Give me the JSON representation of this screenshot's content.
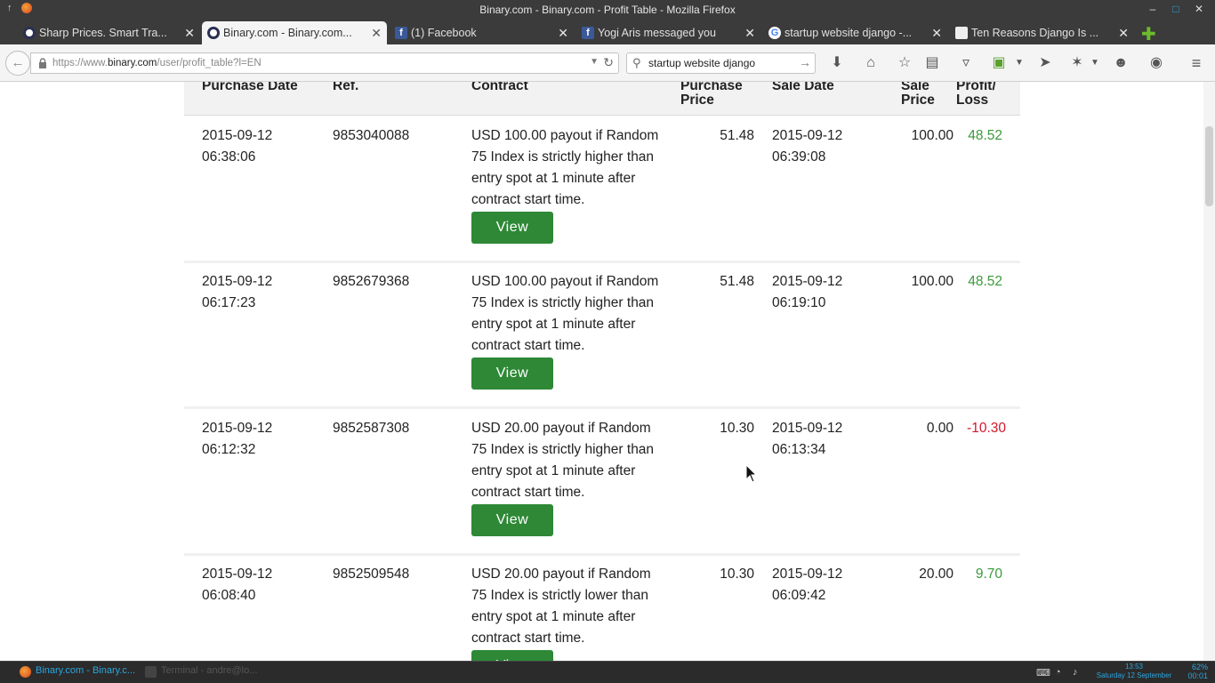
{
  "window": {
    "title": "Binary.com - Binary.com - Profit Table - Mozilla Firefox"
  },
  "tabs": [
    {
      "label": "Sharp Prices. Smart Tra...",
      "icon": "binary-favicon",
      "active": false
    },
    {
      "label": "Binary.com - Binary.com...",
      "icon": "binary-favicon",
      "active": true
    },
    {
      "label": "(1) Facebook",
      "icon": "facebook-favicon",
      "active": false
    },
    {
      "label": "Yogi Aris messaged you",
      "icon": "facebook-favicon",
      "active": false
    },
    {
      "label": "startup website django -...",
      "icon": "google-favicon",
      "active": false
    },
    {
      "label": "Ten Reasons Django Is ...",
      "icon": "calendar-favicon",
      "active": false
    }
  ],
  "nav": {
    "url_prefix": "https://www.",
    "url_host": "binary.com",
    "url_path": "/user/profit_table?l=EN",
    "search_value": "startup website django"
  },
  "table": {
    "headers": {
      "purchase_date": "Purchase Date",
      "ref": "Ref.",
      "contract": "Contract",
      "purchase_price_1": "Purchase",
      "purchase_price_2": "Price",
      "sale_date": "Sale Date",
      "sale_price_1": "Sale",
      "sale_price_2": "Price",
      "profit_1": "Profit/",
      "profit_2": "Loss"
    },
    "view_label": "View",
    "rows": [
      {
        "purchase_date": "2015-09-12",
        "purchase_time": "06:38:06",
        "ref": "9853040088",
        "contract_lines": [
          "USD 100.00 payout if Random",
          "75 Index is strictly higher than",
          "entry spot at 1 minute after",
          "contract start time."
        ],
        "purchase_price": "51.48",
        "sale_date": "2015-09-12",
        "sale_time": "06:39:08",
        "sale_price": "100.00",
        "profit": "48.52",
        "profit_type": "profit"
      },
      {
        "purchase_date": "2015-09-12",
        "purchase_time": "06:17:23",
        "ref": "9852679368",
        "contract_lines": [
          "USD 100.00 payout if Random",
          "75 Index is strictly higher than",
          "entry spot at 1 minute after",
          "contract start time."
        ],
        "purchase_price": "51.48",
        "sale_date": "2015-09-12",
        "sale_time": "06:19:10",
        "sale_price": "100.00",
        "profit": "48.52",
        "profit_type": "profit"
      },
      {
        "purchase_date": "2015-09-12",
        "purchase_time": "06:12:32",
        "ref": "9852587308",
        "contract_lines": [
          "USD 20.00 payout if Random",
          "75 Index is strictly higher than",
          "entry spot at 1 minute after",
          "contract start time."
        ],
        "purchase_price": "10.30",
        "sale_date": "2015-09-12",
        "sale_time": "06:13:34",
        "sale_price": "0.00",
        "profit": "-10.30",
        "profit_type": "loss"
      },
      {
        "purchase_date": "2015-09-12",
        "purchase_time": "06:08:40",
        "ref": "9852509548",
        "contract_lines": [
          "USD 20.00 payout if Random",
          "75 Index is strictly lower than",
          "entry spot at 1 minute after",
          "contract start time."
        ],
        "purchase_price": "10.30",
        "sale_date": "2015-09-12",
        "sale_time": "06:09:42",
        "sale_price": "20.00",
        "profit": "9.70",
        "profit_type": "profit"
      }
    ]
  },
  "taskbar": {
    "items": [
      {
        "label": "Binary.com - Binary.c...",
        "icon": "firefox-icon",
        "active": true
      },
      {
        "label": "Terminal - andre@lo...",
        "icon": "terminal-icon",
        "active": false
      }
    ],
    "clock_time": "13:53",
    "clock_date": "Saturday 12 September",
    "battery_percent": "62%",
    "battery_time": "00:01"
  },
  "colors": {
    "profit": "#3b9a3b",
    "loss": "#d1182a",
    "view_button": "#2e8836",
    "taskbar_accent": "#2aa6e0"
  }
}
